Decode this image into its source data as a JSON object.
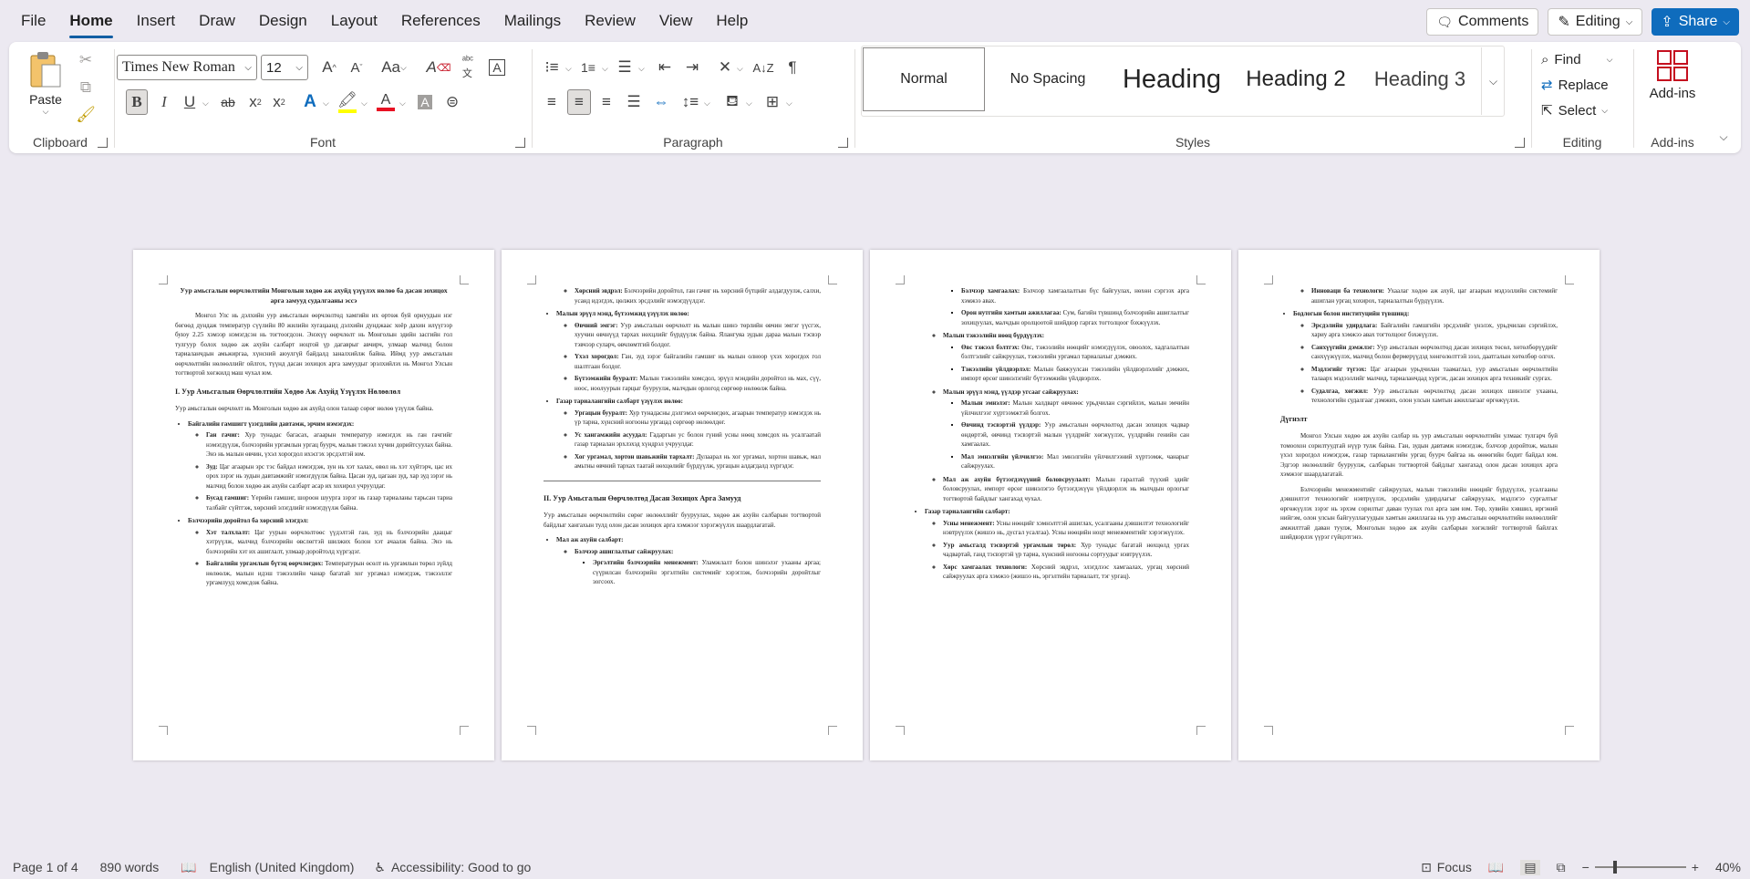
{
  "menu": {
    "tabs": [
      "File",
      "Home",
      "Insert",
      "Draw",
      "Design",
      "Layout",
      "References",
      "Mailings",
      "Review",
      "View",
      "Help"
    ],
    "active": "Home",
    "comments": "Comments",
    "editing": "Editing",
    "share": "Share"
  },
  "ribbon": {
    "clipboard": {
      "label": "Clipboard",
      "paste": "Paste"
    },
    "font": {
      "label": "Font",
      "font_name": "Times New Roman",
      "font_size": "12"
    },
    "paragraph": {
      "label": "Paragraph"
    },
    "styles": {
      "label": "Styles",
      "items": [
        "Normal",
        "No Spacing",
        "Heading",
        "Heading 2",
        "Heading 3"
      ]
    },
    "editing": {
      "label": "Editing",
      "find": "Find",
      "replace": "Replace",
      "select": "Select"
    },
    "addins": {
      "label": "Add-ins",
      "button": "Add-ins"
    }
  },
  "colors": {
    "accent": "#0f6cbd",
    "highlight": "#ffff00",
    "font_color": "#e81123"
  },
  "pages": {
    "p1": {
      "title": "Уур амьсгалын өөрчлөлтийн Монголын хөдөө аж ахуйд үзүүлэх нөлөө ба дасан зохицох арга замууд судалгааны эссэ",
      "intro": "Монгол Улс нь дэлхийн уур амьсгалын өөрчлөлтөд хамгийн их өртөж буй орнуудын нэг бөгөөд дундаж температур сүүлийн 80 жилийн хугацаанд дэлхийн дунджаас хоёр дахин илүүгээр буюу 2.25 хэмээр нэмэгдсэн нь тогтоогдсон. Энэхүү өөрчлөлт нь Монголын эдийн засгийн гол тулгуур болох хөдөө аж ахуйн салбарт ноцтой үр дагаврыг авчирч, улмаар малчид болон тариаланчдын амьжиргаа, хүнсний аюулгүй байдалд заналхийлж байна. Иймд уур амьсгалын өөрчлөлтийн нөлөөллийг ойлгох, түүнд дасан зохицох арга замуудыг эрэлхийлэх нь Монгол Улсын тогтвортой хөгжилд маш чухал юм.",
      "h1": "I. Уур Амьсгалын Өөрчлөлтийн Хөдөө Аж Ахуйд Үзүүлэх Нөлөөлөл",
      "h1_text": "Уур амьсгалын өөрчлөлт нь Монголын хөдөө аж ахуйд олон талаар сөрөг нөлөө үзүүлж байна.",
      "b1": "Байгалийн гамшигт үзэгдлийн давтамж, эрчим нэмэгдэх:",
      "b1_items": [
        {
          "k": "Ган гачиг:",
          "v": "Хур тунадас багасах, агаарын температур нэмэгдэх нь ган гачгийг нэмэгдүүлж, бэлчээрийн ургамлын ургац буурч, малын тэжээл хүчин дорийтсуулах байна. Энэ нь малын өвчин, үхэл хорогдол ихэсгэх эрсдэлтэй юм."
        },
        {
          "k": "Зуд:",
          "v": "Цаг агаарын эрс тэс байдал нэмэгдэж, зун нь хэт халах, өвөл нь хэт хүйтэрч, цас их орох зэрэг нь зудын давтамжийг нэмэгдүүлж байна. Цасан зуд, цагаан зуд, хар зуд зэрэг нь малчид болон хөдөө аж ахуйн салбарт асар их хохирол учруулдаг."
        },
        {
          "k": "Бусад гамшиг:",
          "v": "Үерийн гамшиг, шороон шуурга зэрэг нь газар тариаланы тарьсан тариа талбайг сүйтгэж, хөрсний элэгдлийг нэмэгдүүлж байна."
        }
      ],
      "b2": "Бэлчээрийн доройтол ба хөрсний элэгдэл:",
      "b2_items": [
        {
          "k": "Хэт талхлалт:",
          "v": "Цаг уурын өөрчлөлтөөс үүдэлтэй ган, зуд нь бэлчээрийн даацыг хэтрүүлж, малчид бэлчээрийн өвслөгтэй шилжих болон хэт ачаалж байна. Энэ нь бэлчээрийн хэт их ашиглалт, улмаар доройтолд хүргэдэг."
        },
        {
          "k": "Байгалийн ургамлын бүтэц өөрчлөгдөх:",
          "v": "Температурын өсөлт нь ургамлын төрөл зүйлд нөлөөлж, малын идэш тэжээлийн чанар багатай хог ургамал нэмэгдэж, тэжээллэг ургамлууд хомсдож байна."
        }
      ]
    },
    "p2": {
      "top_items": [
        {
          "k": "Хөрсний эвдрэл:",
          "v": "Бэлчээрийн доройтол, ган гачиг нь хөрсний бүтцийг алдагдуулж, салхи, усанд идэгдэх, цөлжих эрсдэлийг нэмэгдүүлдэг."
        }
      ],
      "b3": "Малын эрүүл мэнд, бүтээмжид үзүүлэх нөлөө:",
      "b3_items": [
        {
          "k": "Өвчний эмгэг:",
          "v": "Уур амьсгалын өөрчлөлт нь малын шинэ төрлийн өвчин эмгэг үүсгэх, хуучин өвчнүүд тархах нөхцлийг бүрдүүлж байна. Ялангуяа зудын дараа малын тэсвэр тэвчээр суларч, өвчлөмтгий болдог."
        },
        {
          "k": "Үхэл хорогдол:",
          "v": "Ган, зуд зэрэг байгалийн гамшиг нь малын олноор үхэх хорогдох гол шалтгаан болдог."
        },
        {
          "k": "Бүтээмжийн бууралт:",
          "v": "Малын тэжээлийн хомсдол, эрүүл мэндийн доройтол нь мах, сүү, ноос, ноолуурын гарцыг бууруулж, малчдын орлогод сөргөөр нөлөөлж байна."
        }
      ],
      "b4": "Газар тариалангийн салбарт үзүүлэх нөлөө:",
      "b4_items": [
        {
          "k": "Ургацын бууралт:",
          "v": "Хур тунадасны дэлгэмэл өөрчлөгдөх, агаарын температур нэмэгдэх нь үр тариа, хүнсний ногооны ургацад сөргөөр нөлөөлдөг."
        },
        {
          "k": "Ус хангамжийн асуудал:",
          "v": "Гадаргын ус болон гүний усны нөөц хомсдох нь усалгаатай газар тариалан эрхлэхэд хүндрэл учруулдаг."
        },
        {
          "k": "Хог ургамал, хортон шавьжийн тархалт:",
          "v": "Дулаарал нь хог ургамал, хортон шавьж, мал амьтны өвчний тархах таатай нөхцөлийг бүрдүүлж, ургацын алдагдалд хүргэдэг."
        }
      ],
      "h2": "II. Уур Амьсгалын Өөрчлөлтөд Дасан Зохицох Арга Замууд",
      "h2_text": "Уур амьсгалын өөрчлөлтийн сөрөг нөлөөллийг бууруулах, хөдөө аж ахуйн салбарын тогтвортой байдлыг хангахын тулд олон дасан зохицох арга хэмжээг хэрэгжүүлэх шаардлагатай.",
      "b5": "Мал аж ахуйн салбарт:",
      "b5_sub": "Бэлчээр ашиглалтыг сайжруулах:",
      "b5_sub_items": [
        {
          "k": "Эргэлтийн бэлчээрийн менежмент:",
          "v": "Уламжлалт болон шинэлэг ухааны аргаа; сүүрилсан бэлчээрийн эргэлтийн системийг хэрэглэж, бэлчээрийн доройтлыг зогсоох."
        }
      ]
    },
    "p3": {
      "top_items": [
        {
          "k": "Бэлчээр хамгаалах:",
          "v": "Бэлчээр хамгаалалтын бүс байгуулах, нөхөн сэргээх арга хэмжээ авах."
        },
        {
          "k": "Орон нутгийн хамтын ажиллагаа:",
          "v": "Сум, багийн түвшинд бэлчээрийн ашиглалтыг зохицуулах, малчдын оролцоотой шийдвэр гаргах тогтолцоог бэхжүүлэх."
        }
      ],
      "b6": "Малын тэжээлийн нөөц бүрдүүлэх:",
      "b6_items": [
        {
          "k": "Өвс тэжээл бэлтгэх:",
          "v": "Өвс, тэжээлийн нөөцийг нэмэгдүүлэх, овоолох, хадгалалтын бэлтгэлийг сайжруулах, тэжээлийн ургамал тариалахыг дэмжих."
        },
        {
          "k": "Тэжээлийн үйлдвэрлэл:",
          "v": "Малын баяжуулсан тэжээлийн үйлдвэрлэлийг дэмжих, импорт өрсөг шинэлэгийг бүтээмжийн үйлдвэрлэх."
        }
      ],
      "b7": "Малын эрүүл мэнд, үүлдэр угсааг сайжруулах:",
      "b7_items": [
        {
          "k": "Малын эмнэлэг:",
          "v": "Малын халдварт өвчнөөс урьдчилан сэргийлэх, малын эмчийн үйлчилгээг хүртээмжтэй болгох."
        },
        {
          "k": "Өвчинд тэсвэртэй үүлдэр:",
          "v": "Уур амьсгалын өөрчлөлтөд дасан зохицох чадвар өндөртэй, өвчинд тэсвэртэй малын үүлдрийг хөгжүүлэх, үүлдрийн генийн сан хамгаалах."
        },
        {
          "k": "Мал эмнэлгийн үйлчилгээ:",
          "v": "Мал эмнэлгийн үйлчилгээний хүртээмж, чанарыг сайжруулах."
        }
      ],
      "b8": "Мал аж ахуйн бүтээгдэхүүний боловсруулалт:",
      "b8_text": "Малын гаралтай түүхий эдийг боловсруулах, импорт өрсөг шинэлэгээ бүтээгдэхүүн үйлдвэрлэх нь малчдын орлогыг тогтвортой байдлыг хангахад чухал.",
      "b9": "Газар тариалангийн салбарт:",
      "b9_items": [
        {
          "k": "Усны менежмент:",
          "v": "Усны нөөцийг хэмнэлттэй ашиглах, усалгааны дэвшилтэт технологийг нэвтрүүлэх (жишээ нь, дусгал усалгаа). Усны нөөцийн ноцт менежментийг хэрэгжүүлэх."
        },
        {
          "k": "Уур амьсгалд тэсвэртэй ургамлын төрөл:",
          "v": "Хур тунадас багатай нөхцөлд ургах чадвартай, ганд тэсвэртэй үр тариа, хүнсний ногооны сортуудыг нэвтрүүлэх."
        },
        {
          "k": "Хөрс хамгаалах технологи:",
          "v": "Хөрсний эвдрэл, элэгдлээс хамгаалах, ургац хөрсний сайжруулах арга хэмжээ (жишээ нь, эргэлтийн тариалалт, тэг ургац)."
        }
      ]
    },
    "p4": {
      "top_items": [
        {
          "k": "Инноваци ба технологи:",
          "v": "Ухаалаг хөдөө аж ахуй, цаг агаарын мэдээллийн системийг ашиглан ургац хохирох, тариалалтын бүрдүүлэх."
        }
      ],
      "b10": "Бодлогын болон институцийн түвшинд:",
      "b10_items": [
        {
          "k": "Эрсдэлийн удирдлага:",
          "v": "Байгалийн гамшгийн эрсдэлийг үнэлэх, урьдчилан сэргийлэх, хариу арга хэмжээ авах тогтолцоог бэхжүүлэх."
        },
        {
          "k": "Санхүүгийн дэмжлэг:",
          "v": "Уур амьсгалын өөрчлөлтөд дасан зохицох төсөл, хөтөлбөрүүдийг санхүүжүүлэх, малчид болон фермерүүдэд хөнгөлөлттэй зээл, даатгалын хөтөлбөр олгох."
        },
        {
          "k": "Мэдлэгийг түгээх:",
          "v": "Цаг агаарын урьдчилан таамаглал, уур амьсгалын өөрчлөлтийн талаарх мэдээллийг малчид, тариаланчдад хүргэх, дасан зохицох арга техникийг сургах."
        },
        {
          "k": "Судалгаа, хөгжил:",
          "v": "Уур амьсгалын өөрчлөлтөд дасан зохицох шинэлэг ухааны, технологийн судалгааг дэмжих, олон улсын хамтын ажиллагааг өргөжүүлэх."
        }
      ],
      "concl_title": "Дүгнэлт",
      "concl_1": "Монгол Улсын хөдөө аж ахуйн салбар нь уур амьсгалын өөрчлөлтийн улмаас тулгарч буй томоохон сорилтуудтай нүүр тулж байна. Ган, зудын давтамж нэмэгдэж, бэлчээр доройтож, малын үхэл хорогдол нэмэгдэж, газар тариалангийн ургац буурч байгаа нь өнөөгийн бодит байдал юм. Эдгээр нөлөөллийг бууруулж, салбарын тогтвортой байдлыг хангахад олон дасан зохицох арга хэмжээг шаардлагатай.",
      "concl_2": "Бэлчээрийн менежментийг сайжруулах, малын тэжээлийн нөөцийг бүрдүүлэх, усалгааны дэвшилтэт технологийг нэвтрүүлэх, эрсдэлийн удирдлагыг сайжруулах, мэдлэгээ сургалтыг өргөжүүлэх зэрэг нь эрхэм сорилтыг даван туулах гол арга зам юм. Төр, хувийн хэвшил, иргэний нийгэм, олон улсын байгууллагуудын хамтын ажиллагаа нь уур амьсгалын өөрчлөлтийн нөлөөллийг амжилттай даван туулж, Монголын хөдөө аж ахуйн салбарын хөгжлийг тогтвортой байлгах шийдвэрлэх үүрэг гүйцэтгэнэ."
    }
  },
  "status": {
    "page": "Page 1 of 4",
    "words": "890 words",
    "language": "English (United Kingdom)",
    "accessibility": "Accessibility: Good to go",
    "focus": "Focus",
    "zoom": "40%"
  }
}
